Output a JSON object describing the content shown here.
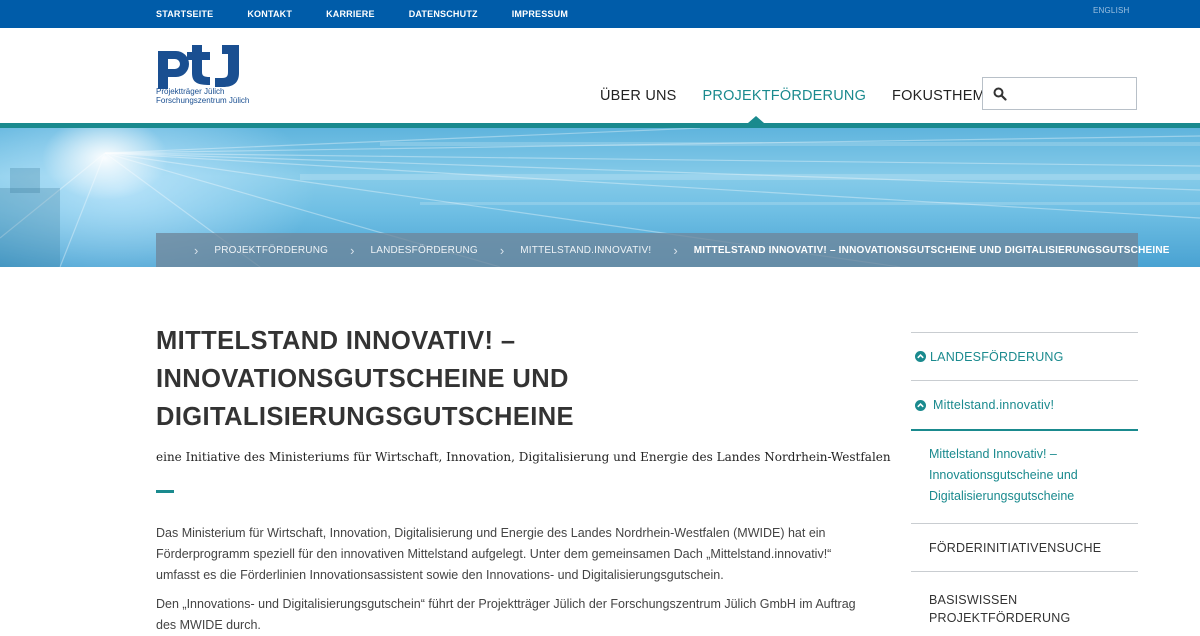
{
  "topbar": {
    "links": [
      "STARTSEITE",
      "KONTAKT",
      "KARRIERE",
      "DATENSCHUTZ",
      "IMPRESSUM"
    ],
    "language": "ENGLISH"
  },
  "logo": {
    "mark": "ptJ",
    "line1": "Projektträger Jülich",
    "line2": "Forschungszentrum Jülich"
  },
  "mainnav": {
    "items": [
      "ÜBER UNS",
      "PROJEKTFÖRDERUNG",
      "FOKUSTHEMEN"
    ],
    "active": "PROJEKTFÖRDERUNG"
  },
  "search": {
    "placeholder": "",
    "value": ""
  },
  "breadcrumb": {
    "items": [
      "PROJEKTFÖRDERUNG",
      "LANDESFÖRDERUNG",
      "MITTELSTAND.INNOVATIV!"
    ],
    "current": "MITTELSTAND INNOVATIV! – INNOVATIONSGUTSCHEINE UND DIGITALISIERUNGSGUTSCHEINE"
  },
  "main": {
    "title": "MITTELSTAND INNOVATIV! – INNOVATIONSGUTSCHEINE UND DIGITALISIERUNGSGUTSCHEINE",
    "lead": "eine Initiative des Ministeriums für Wirtschaft, Innovation, Digitalisierung und Energie des Landes Nordrhein-Westfalen",
    "paragraphs": [
      "Das Ministerium für Wirtschaft, Innovation, Digitalisierung und Energie des Landes Nordrhein-Westfalen (MWIDE) hat ein Förderprogramm speziell für den innovativen Mittelstand aufgelegt. Unter dem gemeinsamen Dach „Mittelstand.innovativ!“ umfasst es die Förderlinien Innovationsassistent sowie den Innovations- und Digitalisierungsgutschein.",
      "Den „Innovations- und Digitalisierungsgutschein“ führt der Projektträger Jülich der Forschungszentrum Jülich GmbH im Auftrag des MWIDE durch."
    ]
  },
  "sidebar": {
    "level1": "LANDESFÖRDERUNG",
    "level2": "Mittelstand.innovativ!",
    "level3": "Mittelstand Innovativ! – Innovationsgutscheine und Digitalisierungsgutscheine",
    "item_search": "FÖRDERINITIATIVENSUCHE",
    "item_basics": "BASISWISSEN PROJEKTFÖRDERUNG"
  },
  "colors": {
    "topbar": "#005ca9",
    "accent": "#1a8a8e",
    "logo": "#1a4f91",
    "breadcrumb_bg": "#6e879b"
  },
  "icons": [
    "home-icon",
    "search-icon",
    "chevron-up-circle-icon"
  ]
}
